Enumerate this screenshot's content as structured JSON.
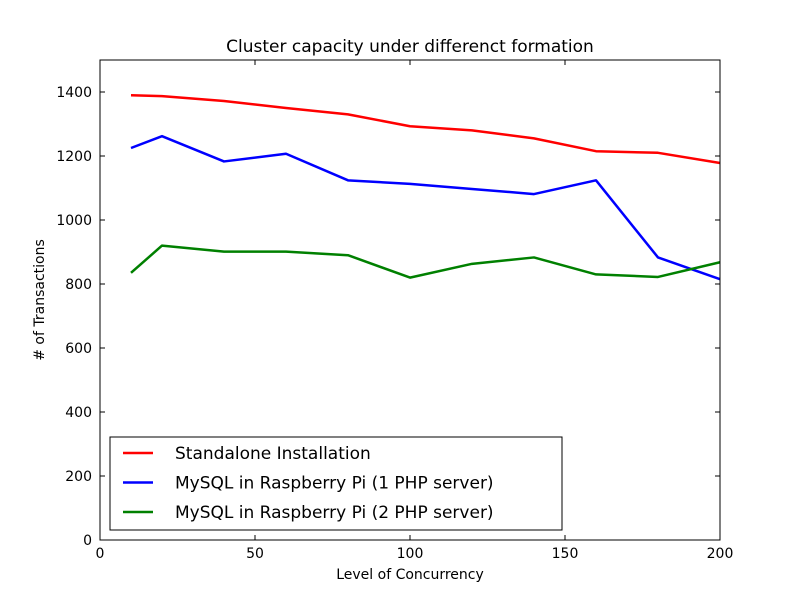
{
  "chart_data": {
    "type": "line",
    "title": "Cluster capacity under differenct formation",
    "xlabel": "Level of Concurrency",
    "ylabel": "# of Transactions",
    "xlim": [
      0,
      200
    ],
    "ylim": [
      0,
      1500
    ],
    "x_ticks": [
      0,
      50,
      100,
      150,
      200
    ],
    "y_ticks": [
      0,
      200,
      400,
      600,
      800,
      1000,
      1200,
      1400
    ],
    "x_tick_labels": [
      "0",
      "50",
      "100",
      "150",
      "200"
    ],
    "y_tick_labels": [
      "0",
      "200",
      "400",
      "600",
      "800",
      "1000",
      "1200",
      "1400"
    ],
    "grid": false,
    "legend_position": "lower-left",
    "x": [
      10,
      20,
      40,
      60,
      80,
      100,
      120,
      140,
      160,
      180,
      200
    ],
    "series": [
      {
        "name": "Standalone Installation",
        "color": "#ff0000",
        "values": [
          1390,
          1387,
          1372,
          1350,
          1330,
          1293,
          1280,
          1255,
          1215,
          1210,
          1178
        ]
      },
      {
        "name": "MySQL in Raspberry Pi (1 PHP server)",
        "color": "#0000ff",
        "values": [
          1225,
          1262,
          1183,
          1207,
          1124,
          1113,
          1097,
          1081,
          1124,
          883,
          815
        ]
      },
      {
        "name": "MySQL in Raspberry Pi (2 PHP server)",
        "color": "#008000",
        "values": [
          835,
          920,
          901,
          901,
          890,
          820,
          863,
          883,
          830,
          822,
          868
        ]
      }
    ]
  }
}
